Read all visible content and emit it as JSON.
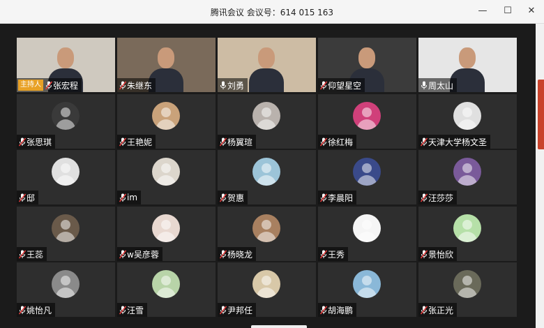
{
  "window": {
    "title": "腾讯会议 会议号：614 015 163",
    "minimize": "—",
    "maximize": "☐",
    "close": "✕"
  },
  "host_badge": "主持人",
  "participants": [
    {
      "name": "张宏程",
      "host": true,
      "video": true,
      "mic": "muted",
      "bg": "#cfc9bf"
    },
    {
      "name": "朱继东",
      "video": true,
      "mic": "muted",
      "bg": "#7a6a5a"
    },
    {
      "name": "刘勇",
      "video": true,
      "mic": "on",
      "bg": "#cdbca4"
    },
    {
      "name": "仰望星空",
      "video": true,
      "mic": "muted",
      "bg": "#3b3b3b"
    },
    {
      "name": "周太山",
      "video": true,
      "mic": "on",
      "bg": "#e6e6e6"
    },
    {
      "name": "张思琪",
      "mic": "muted",
      "avatar_color": "#3a3a3a"
    },
    {
      "name": "王艳妮",
      "mic": "muted",
      "avatar_color": "#c9a27a"
    },
    {
      "name": "杨翼瑄",
      "mic": "muted",
      "avatar_color": "#b9b2ad"
    },
    {
      "name": "徐红梅",
      "mic": "muted",
      "avatar_color": "#d0407a"
    },
    {
      "name": "天津大学杨文圣",
      "mic": "muted",
      "avatar_color": "#e0e0e0"
    },
    {
      "name": "邸",
      "mic": "muted",
      "avatar_color": "#e0e0e0"
    },
    {
      "name": "im",
      "mic": "muted",
      "avatar_color": "#dcd6cc"
    },
    {
      "name": "贺惠",
      "mic": "muted",
      "avatar_color": "#9cc4d8"
    },
    {
      "name": "李晨阳",
      "mic": "muted",
      "avatar_color": "#3a4a8a"
    },
    {
      "name": "汪莎莎",
      "mic": "muted",
      "avatar_color": "#7a5a9a"
    },
    {
      "name": "王蕊",
      "mic": "muted",
      "avatar_color": "#6a5a4a"
    },
    {
      "name": "w吴彦蓉",
      "mic": "muted",
      "avatar_color": "#e8d8d0"
    },
    {
      "name": "杨晓龙",
      "mic": "muted",
      "avatar_color": "#a88060"
    },
    {
      "name": "王秀",
      "mic": "muted",
      "avatar_color": "#f5f5f5"
    },
    {
      "name": "景怡欣",
      "mic": "muted",
      "avatar_color": "#b6e0a8"
    },
    {
      "name": "姚怡凡",
      "mic": "muted",
      "avatar_color": "#8a8a8a"
    },
    {
      "name": "汪雪",
      "mic": "muted",
      "avatar_color": "#b8d4a8"
    },
    {
      "name": "尹邦任",
      "mic": "muted",
      "avatar_color": "#d8c8a8"
    },
    {
      "name": "胡海鹏",
      "mic": "muted",
      "avatar_color": "#8ab8d8"
    },
    {
      "name": "张正光",
      "mic": "muted",
      "avatar_color": "#6a6a5a"
    }
  ],
  "icons": {
    "mic_on": "microphone-icon",
    "mic_muted": "microphone-muted-icon"
  }
}
